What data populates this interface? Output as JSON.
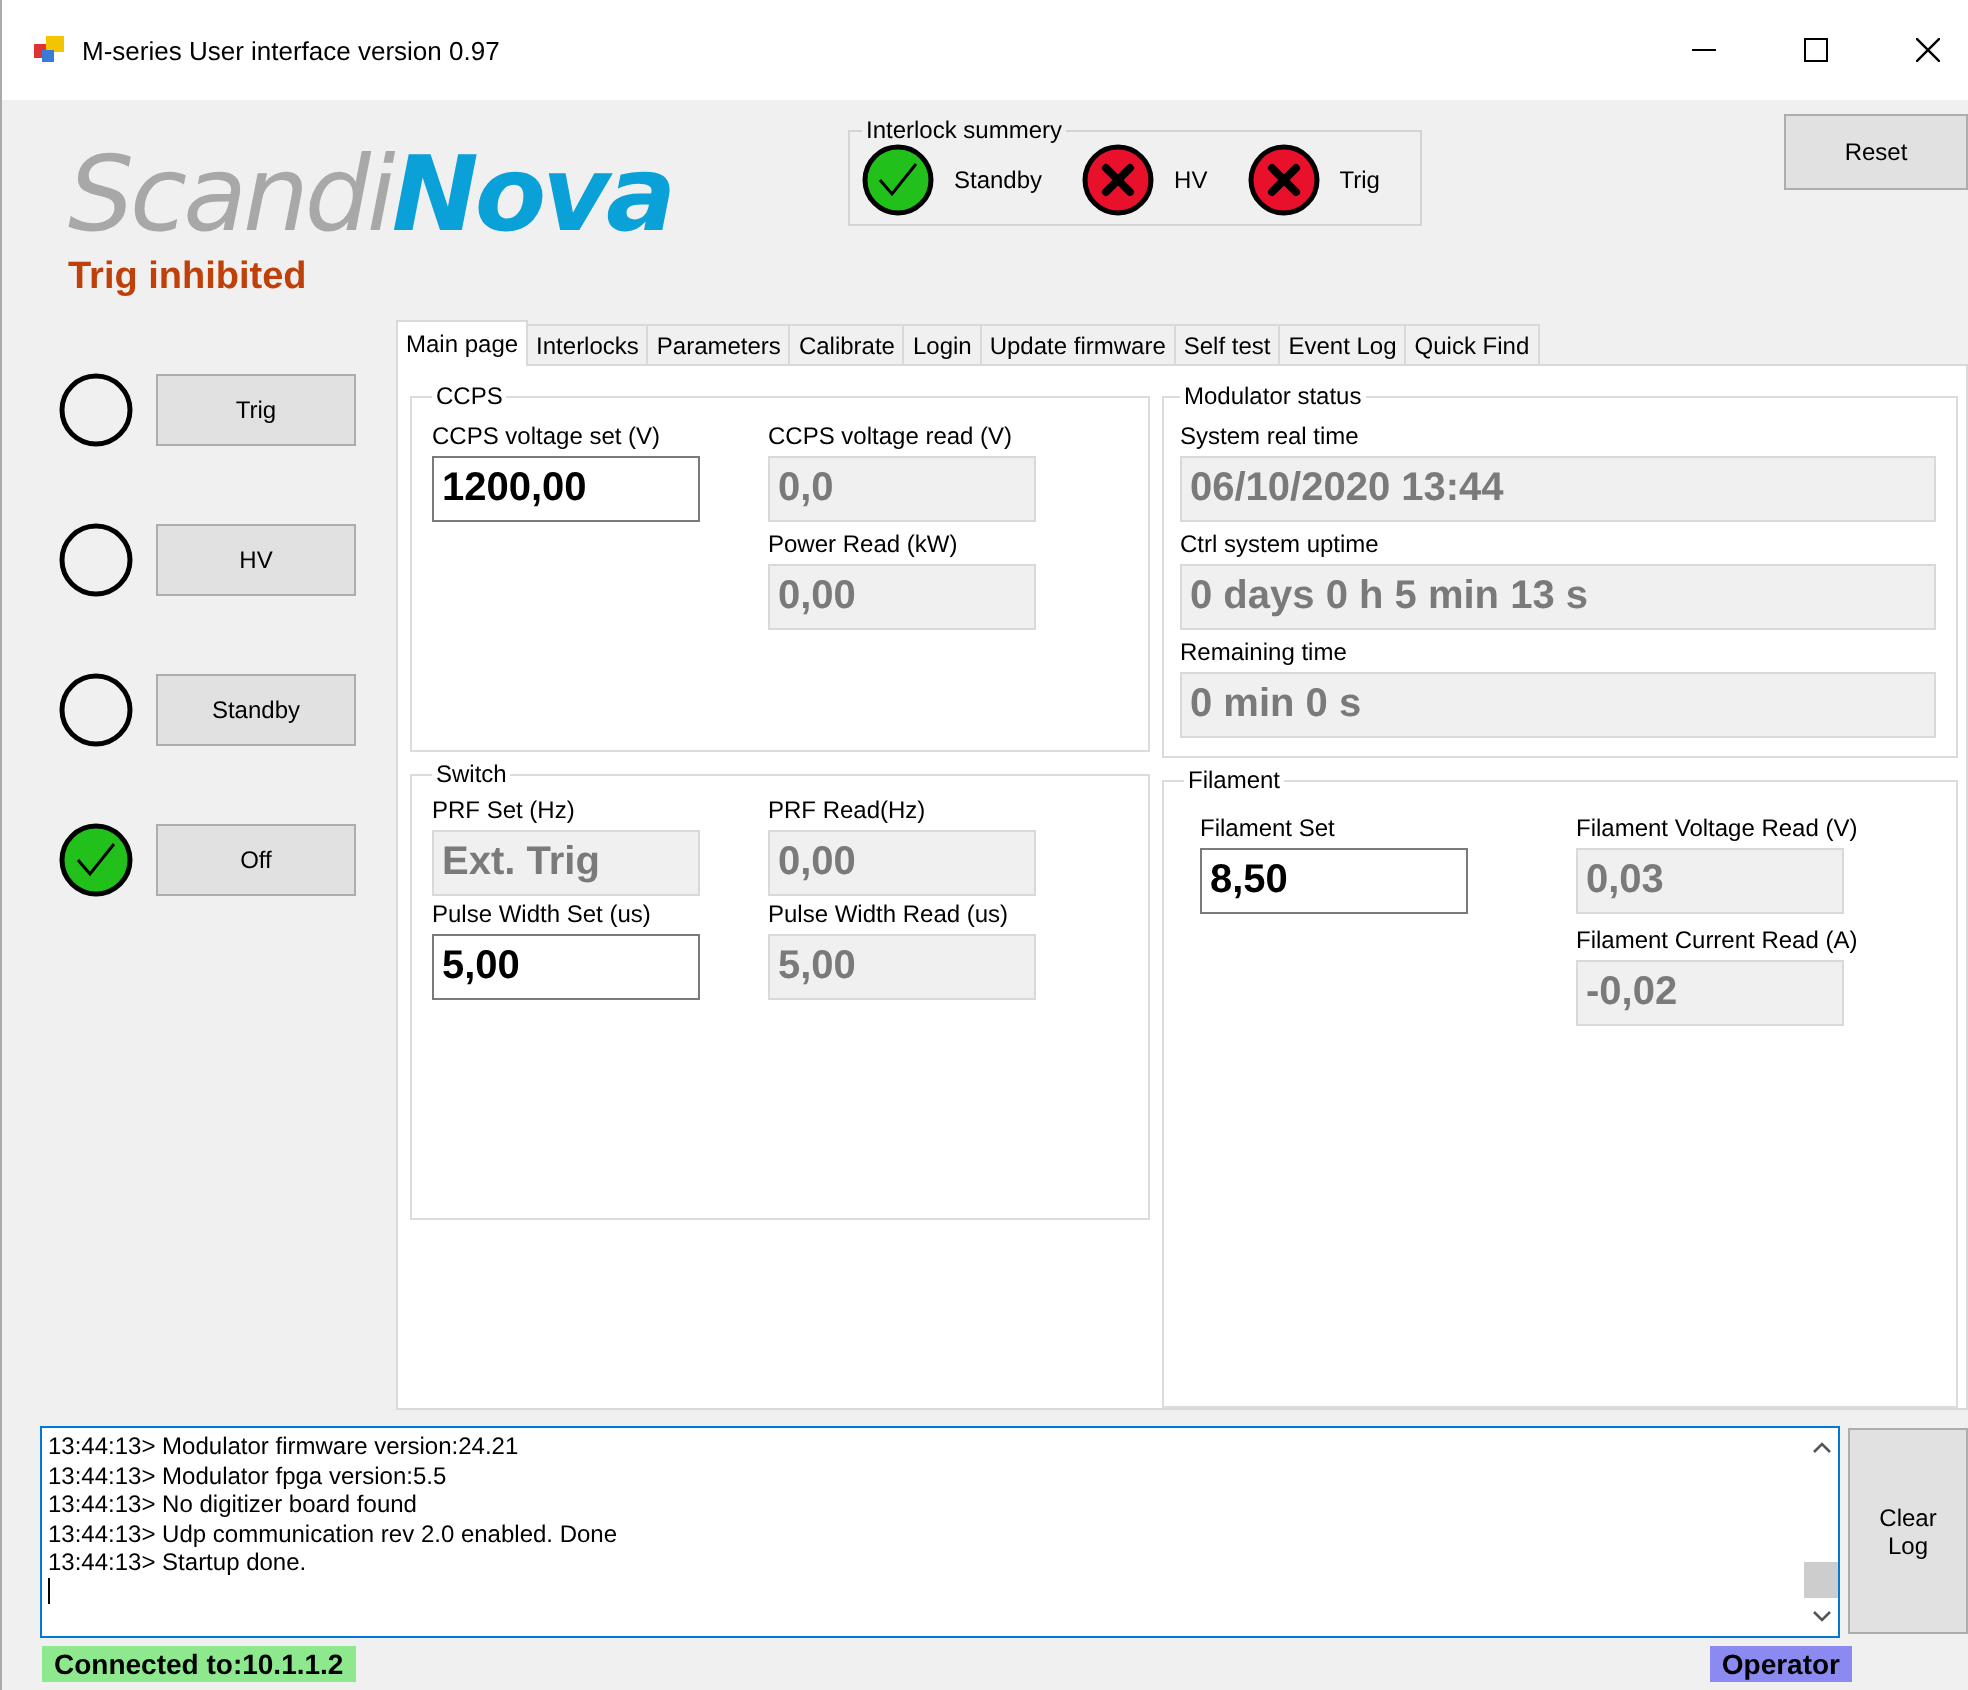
{
  "window": {
    "title": "M-series User interface version 0.97"
  },
  "logo": {
    "part_1": "Scandi",
    "part_2": "Nova"
  },
  "status_message": "Trig inhibited",
  "interlock_summary": {
    "title": "Interlock summery",
    "items": [
      {
        "label": "Standby",
        "ok": true
      },
      {
        "label": "HV",
        "ok": false
      },
      {
        "label": "Trig",
        "ok": false
      }
    ]
  },
  "reset_button": "Reset",
  "state_buttons": [
    {
      "label": "Trig",
      "active": false
    },
    {
      "label": "HV",
      "active": false
    },
    {
      "label": "Standby",
      "active": false
    },
    {
      "label": "Off",
      "active": true
    }
  ],
  "tabs": [
    {
      "label": "Main page",
      "selected": true
    },
    {
      "label": "Interlocks",
      "selected": false
    },
    {
      "label": "Parameters",
      "selected": false
    },
    {
      "label": "Calibrate",
      "selected": false
    },
    {
      "label": "Login",
      "selected": false
    },
    {
      "label": "Update firmware",
      "selected": false
    },
    {
      "label": "Self test",
      "selected": false
    },
    {
      "label": "Event Log",
      "selected": false
    },
    {
      "label": "Quick Find",
      "selected": false
    }
  ],
  "ccps": {
    "title": "CCPS",
    "fields": [
      {
        "label": "CCPS voltage set (V)",
        "value": "1200,00",
        "editable": true
      },
      {
        "label": "CCPS voltage read (V)",
        "value": "0,0",
        "editable": false
      },
      {
        "label": "Power Read (kW)",
        "value": "0,00",
        "editable": false
      }
    ]
  },
  "switch": {
    "title": "Switch",
    "fields": [
      {
        "label": "PRF Set (Hz)",
        "value": "Ext. Trig",
        "editable": false
      },
      {
        "label": "PRF Read(Hz)",
        "value": "0,00",
        "editable": false
      },
      {
        "label": "Pulse Width Set (us)",
        "value": "5,00",
        "editable": true
      },
      {
        "label": "Pulse Width Read (us)",
        "value": "5,00",
        "editable": false
      }
    ]
  },
  "modulator_status": {
    "title": "Modulator status",
    "fields": [
      {
        "label": "System real time",
        "value": "06/10/2020 13:44",
        "editable": false
      },
      {
        "label": "Ctrl system uptime",
        "value": "0 days 0 h 5 min 13 s",
        "editable": false
      },
      {
        "label": "Remaining time",
        "value": "0 min 0 s",
        "editable": false
      }
    ]
  },
  "filament": {
    "title": "Filament",
    "fields": [
      {
        "label": "Filament Set",
        "value": "8,50",
        "editable": true
      },
      {
        "label": "Filament Voltage Read (V)",
        "value": "0,03",
        "editable": false
      },
      {
        "label": "Filament Current Read (A)",
        "value": "-0,02",
        "editable": false
      }
    ]
  },
  "log": {
    "lines": [
      "13:44:13> Modulator firmware version:24.21",
      "13:44:13> Modulator fpga version:5.5",
      "13:44:13> No digitizer board found",
      "13:44:13> Udp communication rev 2.0 enabled. Done",
      "13:44:13> Startup done."
    ]
  },
  "clear_log_button": "Clear Log",
  "status_bar": {
    "connection": "Connected to:10.1.1.2",
    "role": "Operator"
  }
}
